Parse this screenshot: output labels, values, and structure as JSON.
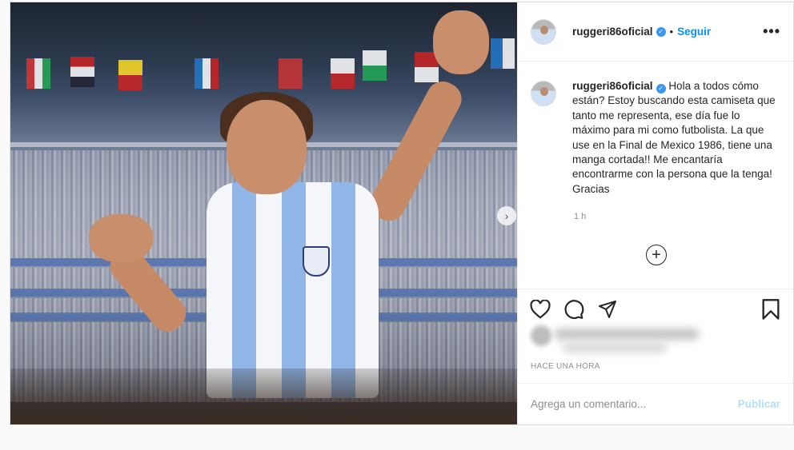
{
  "post": {
    "author": "ruggeri86oficial",
    "verified_icon": "verified-badge-icon",
    "separator": "•",
    "follow_label": "Seguir",
    "more_icon": "more-options-icon",
    "more_label": "•••",
    "caption_text": "Hola a todos cómo están? Estoy buscando esta camiseta que tanto me representa, ese día fue lo máximo para mi como futbolista. La que use en la Final de Mexico 1986, tiene una manga cortada!! Me encantaría encontrarme con la persona que la tenga! Gracias",
    "caption_time": "1 h",
    "load_more_label": "+",
    "posted_ago": "Hace una hora",
    "next_label": "›"
  },
  "comment": {
    "placeholder": "Agrega un comentario...",
    "publish_label": "Publicar"
  },
  "colors": {
    "accent": "#0095f6",
    "publish_disabled": "#b2dffc",
    "verified": "#3897f0"
  }
}
